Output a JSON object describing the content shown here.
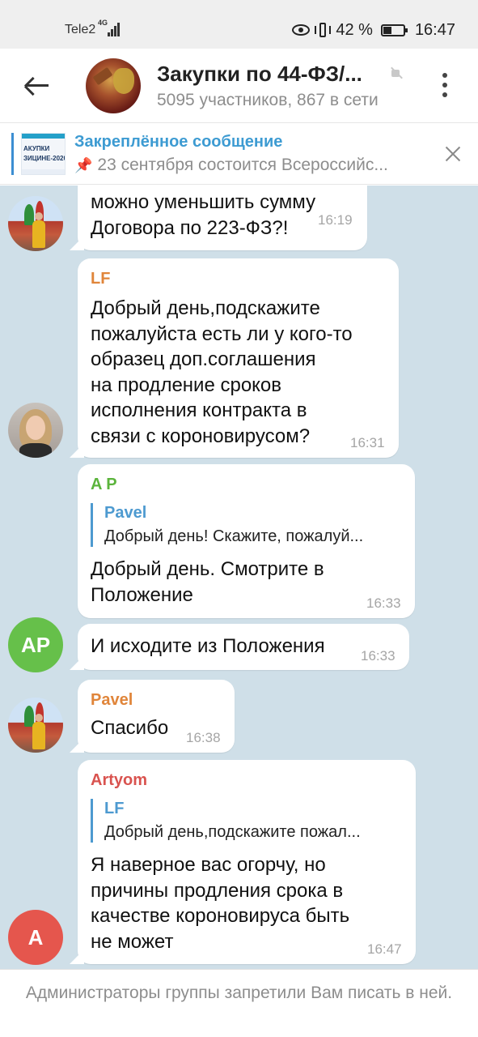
{
  "status_bar": {
    "carrier": "Tele2",
    "network": "4G",
    "battery": "42 %",
    "battery_level": 0.42,
    "time": "16:47"
  },
  "header": {
    "title": "Закупки по 44-ФЗ/...",
    "subtitle": "5095 участников, 867 в сети"
  },
  "pinned": {
    "title": "Закреплённое сообщение",
    "text": "23 сентября состоится Всероссийс...",
    "thumb_line1": "АКУПКИ",
    "thumb_line2": "ЗИЦИНЕ-2020"
  },
  "messages": [
    {
      "text": "можно уменьшить сумму\nДоговора по 223-ФЗ?!",
      "time": "16:19"
    },
    {
      "sender": "LF",
      "sender_color": "#e0853a",
      "text": "Добрый день,подскажите\nпожалуйста есть ли у кого-то\nобразец доп.соглашения\nна продление сроков\nисполнения контракта в\nсвязи с короновирусом?",
      "time": "16:31"
    },
    {
      "sender": "A P",
      "sender_color": "#5bb43c",
      "reply_name": "Pavel",
      "reply_text": "Добрый день! Скажите, пожалуй...",
      "text": "Добрый день. Смотрите в\nПоложение",
      "time": "16:33"
    },
    {
      "text": "И исходите из Положения",
      "time": "16:33",
      "avatar_initials": "AP",
      "avatar_color": "#66c04a"
    },
    {
      "sender": "Pavel",
      "sender_color": "#e0853a",
      "text": "Спасибо",
      "time": "16:38"
    },
    {
      "sender": "Artyom",
      "sender_color": "#d9534f",
      "reply_name": "LF",
      "reply_text": "Добрый день,подскажите пожал...",
      "text": "Я наверное вас огорчу, но\nпричины продления срока в\nкачестве короновируса быть\nне может",
      "time": "16:47",
      "avatar_initials": "A",
      "avatar_color": "#e5564d"
    }
  ],
  "footer": {
    "text": "Администраторы группы запретили Вам писать в ней."
  }
}
